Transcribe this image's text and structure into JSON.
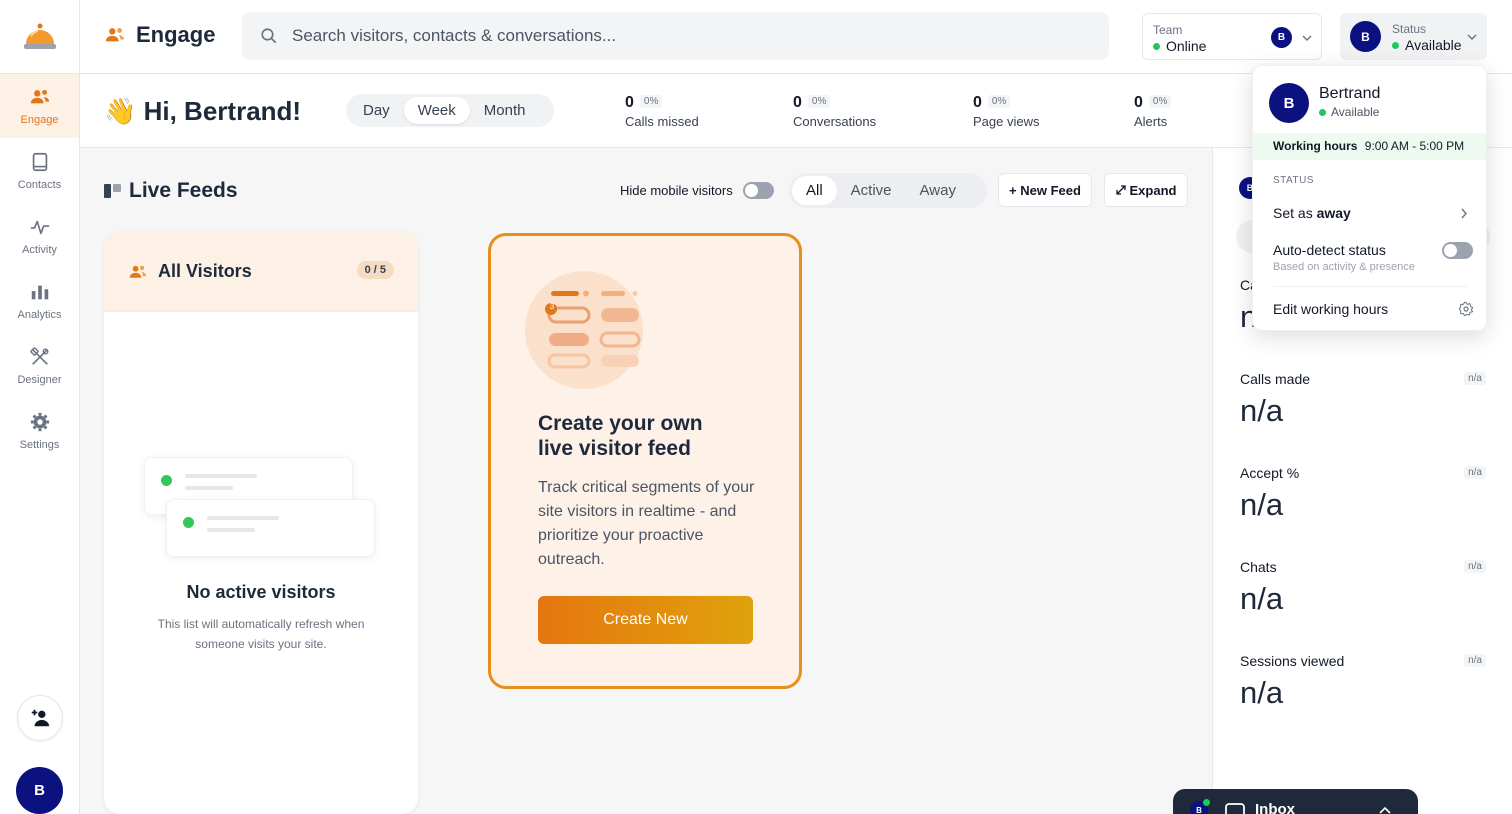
{
  "brand": {
    "title": "Engage"
  },
  "search": {
    "placeholder": "Search visitors, contacts & conversations..."
  },
  "team": {
    "label": "Team",
    "value": "Online",
    "avatar": "B"
  },
  "status": {
    "label": "Status",
    "value": "Available",
    "avatar": "B"
  },
  "sidebar": {
    "items": [
      {
        "label": "Engage"
      },
      {
        "label": "Contacts"
      },
      {
        "label": "Activity"
      },
      {
        "label": "Analytics"
      },
      {
        "label": "Designer"
      },
      {
        "label": "Settings"
      }
    ],
    "avatar": "B"
  },
  "greeting": {
    "emoji": "👋",
    "text": "Hi, Bertrand!"
  },
  "period": {
    "options": [
      "Day",
      "Week",
      "Month"
    ],
    "selected": "Week"
  },
  "kpis": [
    {
      "value": "0",
      "pct": "0%",
      "label": "Calls missed"
    },
    {
      "value": "0",
      "pct": "0%",
      "label": "Conversations"
    },
    {
      "value": "0",
      "pct": "0%",
      "label": "Page views"
    },
    {
      "value": "0",
      "pct": "0%",
      "label": "Alerts"
    }
  ],
  "feeds": {
    "title": "Live Feeds",
    "hide_mobile_label": "Hide mobile visitors",
    "filters": [
      "All",
      "Active",
      "Away"
    ],
    "selected_filter": "All",
    "new_feed_label": "+ New Feed",
    "expand_label": "Expand"
  },
  "visitors_card": {
    "title": "All Visitors",
    "count": "0 / 5",
    "empty_title": "No active visitors",
    "empty_text": "This list will automatically refresh when someone visits your site."
  },
  "create_card": {
    "badge": "3",
    "title_line1": "Create your own",
    "title_line2": "live visitor feed",
    "text": "Track critical segments of your site visitors in realtime - and prioritize your proactive outreach.",
    "button": "Create New"
  },
  "right_panel": {
    "avatar": "B",
    "metrics": [
      {
        "label": "Ca",
        "value": "n/",
        "badge": ""
      },
      {
        "label": "Calls made",
        "value": "n/a",
        "badge": "n/a"
      },
      {
        "label": "Accept %",
        "value": "n/a",
        "badge": "n/a"
      },
      {
        "label": "Chats",
        "value": "n/a",
        "badge": "n/a"
      },
      {
        "label": "Sessions viewed",
        "value": "n/a",
        "badge": "n/a"
      }
    ]
  },
  "inbox": {
    "label": "Inbox",
    "avatar": "B"
  },
  "status_menu": {
    "avatar": "B",
    "name": "Bertrand",
    "availability": "Available",
    "hours_label": "Working hours",
    "hours_value": "9:00 AM - 5:00 PM",
    "section_label": "STATUS",
    "set_away_prefix": "Set as",
    "set_away_emphasis": "away",
    "auto_detect_label": "Auto-detect status",
    "auto_detect_sub": "Based on activity & presence",
    "edit_hours_label": "Edit working hours"
  },
  "colors": {
    "accent": "#e0781a",
    "navy": "#0b1280",
    "online_green": "#22c55e",
    "card_border": "#e58f1d"
  }
}
